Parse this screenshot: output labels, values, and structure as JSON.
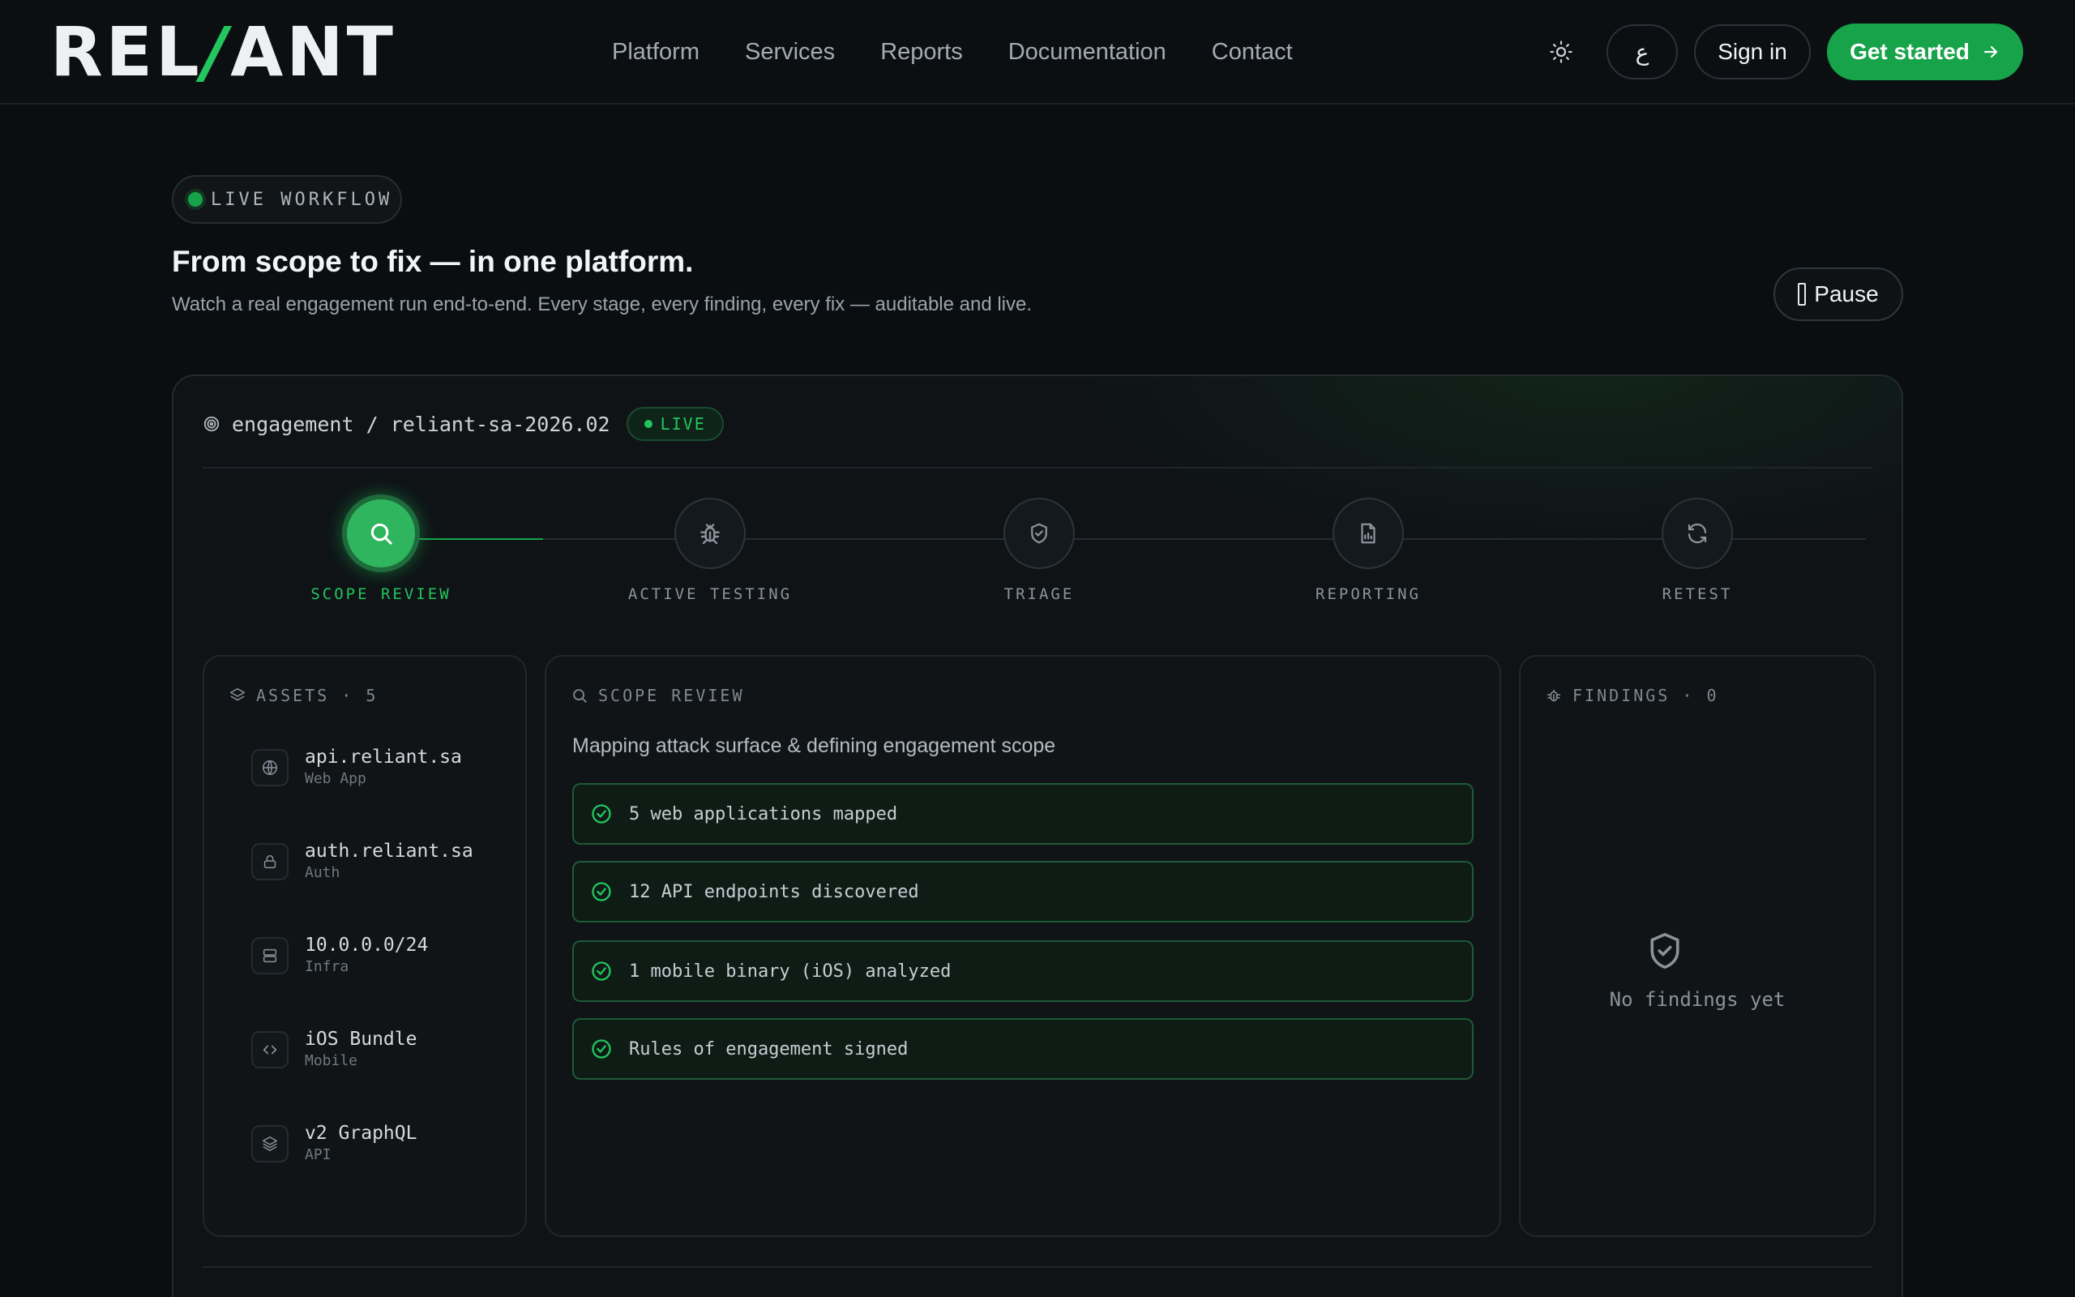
{
  "header": {
    "logo_start": "REL",
    "logo_slash": "/",
    "logo_end": "ANT",
    "nav": [
      "Platform",
      "Services",
      "Reports",
      "Documentation",
      "Contact"
    ],
    "theme_icon": "sun-icon",
    "lang_label": "ع",
    "signin_label": "Sign in",
    "start_label": "Get started"
  },
  "hero": {
    "badge": "LIVE WORKFLOW",
    "title": "From scope to fix — in one platform.",
    "subtitle": "Watch a real engagement run end-to-end. Every stage, every finding, every fix — auditable and live.",
    "pause_label": "Pause"
  },
  "engagement": {
    "path": "engagement / reliant-sa-2026.02",
    "status": "LIVE",
    "steps": [
      {
        "label": "SCOPE REVIEW",
        "icon": "search-icon"
      },
      {
        "label": "ACTIVE TESTING",
        "icon": "bug-icon"
      },
      {
        "label": "TRIAGE",
        "icon": "shield-check-icon"
      },
      {
        "label": "REPORTING",
        "icon": "report-icon"
      },
      {
        "label": "RETEST",
        "icon": "refresh-icon"
      }
    ],
    "active_step": 0
  },
  "assets": {
    "title": "ASSETS · 5",
    "items": [
      {
        "name": "api.reliant.sa",
        "type": "Web App",
        "icon": "globe-icon"
      },
      {
        "name": "auth.reliant.sa",
        "type": "Auth",
        "icon": "lock-icon"
      },
      {
        "name": "10.0.0.0/24",
        "type": "Infra",
        "icon": "server-icon"
      },
      {
        "name": "iOS Bundle",
        "type": "Mobile",
        "icon": "code-icon"
      },
      {
        "name": "v2 GraphQL",
        "type": "API",
        "icon": "layers-icon"
      }
    ]
  },
  "scope": {
    "title": "SCOPE REVIEW",
    "description": "Mapping attack surface & defining engagement scope",
    "checks": [
      "5 web applications mapped",
      "12 API endpoints discovered",
      "1 mobile binary (iOS) analyzed",
      "Rules of engagement signed"
    ]
  },
  "findings": {
    "title": "FINDINGS · 0",
    "empty_label": "No findings yet"
  },
  "colors": {
    "accent": "#22c55e",
    "background": "#0b0e11"
  }
}
